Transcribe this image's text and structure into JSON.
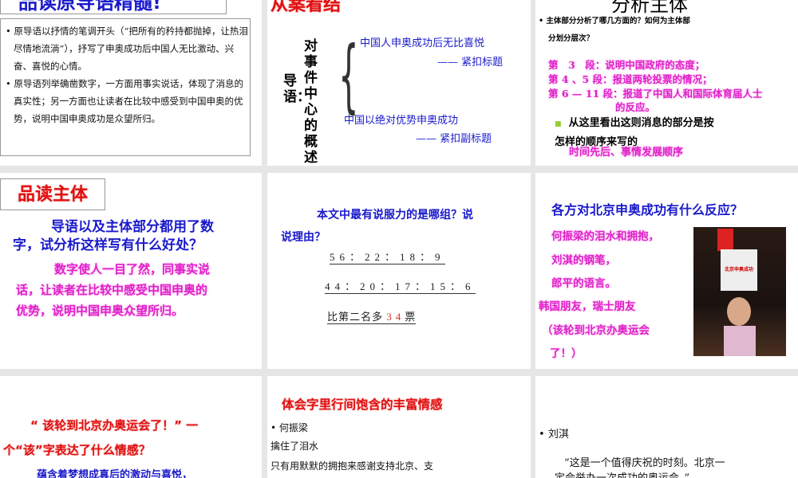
{
  "slides": [
    {
      "title": "品读原导语精髓!",
      "bullets": [
        "原导语以抒情的笔调开头（“把所有的矜持都抛掉，让热泪尽情地流淌”），抒写了申奥成功后中国人无比激动、兴奋、喜悦的心情。",
        "原导语列举确凿数字，一方面用事实说话，体现了消息的真实性；另一方面也让读者在比较中感受到中国申奥的优势，说明中国申奥成功是众望所归。"
      ]
    },
    {
      "title": "从案看结",
      "label": "导语：",
      "vertical": "对事件中心的概述",
      "line1": "中国人申奥成功后无比喜悦",
      "line1b": "—— 紧扣标题",
      "line2": "中国以绝对优势申奥成功",
      "line2b": "—— 紧扣副标题"
    },
    {
      "title": "分析主体",
      "q1": "主体部分分析了哪几方面的？如何为主体部",
      "q1b": "分划分层次？",
      "a": [
        "第　3　段：说明中国政府的态度；",
        "第 4 、5 段：报道两轮投票的情况；",
        "第 6 — 11 段：报道了中国人和国际体育届人士",
        "的反应。"
      ],
      "q2": "从这里看出这则消息的部分是按",
      "q2b": "怎样的顺序来写的",
      "a2": "时间先后、事情发展顺序"
    },
    {
      "title": "品读主体",
      "q": "导语以及主体部分都用了数",
      "q2": "字，试分析这样写有什么好处？",
      "a": [
        "数字使人一目了然，同事实说",
        "话，让读者在比较中感受中国申奥的",
        "优势，说明中国申奥众望所归。"
      ]
    },
    {
      "q": "本文中最有说服力的是哪组？说",
      "q2": "说理由？",
      "row1": "56：22：18：9",
      "row2": "44：20：17：15：6",
      "row3a": "比第二名多",
      "row3b": "34",
      "row3c": "票"
    },
    {
      "q": "各方对北京申奥成功有什么反应？",
      "a": [
        "何振梁的泪水和拥抱，",
        "刘淇的钢笔，",
        "郎平的语言。",
        "韩国朋友，瑞士朋友",
        "（该轮到北京办奥运会",
        "了！）"
      ],
      "photo_caption": "北京申奥成功"
    },
    {
      "q": "“ 该轮到北京办奥运会了！” 一",
      "q2": "个“该”字表达了什么情感？",
      "a": "蕴含着梦想成真后的激动与喜悦，"
    },
    {
      "title": "体会字里行间饱含的丰富情感",
      "bullet": "何振梁",
      "l1": "擒住了泪水",
      "l2": "只有用默默的拥抱来感谢支持北京、支"
    },
    {
      "bullet": "刘淇",
      "quote": "“这是一个值得庆祝的时刻。北京一",
      "quote2": "定会举办一次成功的奥运会。”"
    }
  ]
}
